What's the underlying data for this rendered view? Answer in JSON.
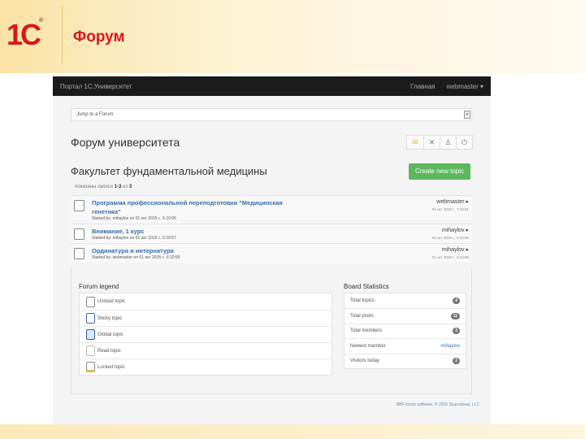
{
  "header": {
    "logo": "1С",
    "title": "Форум"
  },
  "nav": {
    "brand": "Портал 1С:Университет",
    "home": "Главная",
    "user": "webmaster ▾"
  },
  "jump": {
    "value": "Jump to a Forum"
  },
  "forum_title": "Форум университета",
  "toolbar_icons": [
    "envelope-icon",
    "tools-icon",
    "user-icon",
    "power-icon"
  ],
  "faculty_title": "Факультет фундаментальной медицины",
  "create_label": "Create new topic",
  "count": {
    "prefix": "показаны записи ",
    "range": "1-3",
    "mid": " из ",
    "total": "3"
  },
  "topics": [
    {
      "title": "Программа профессиональной переподготовки \"Медицинская генетика\"",
      "started": "Started by: mihaylov on 01 окт 2015 г., 6:10:06",
      "last_user": "webmaster ▸",
      "last_date": "01 окт 2015 г., 7:10:01"
    },
    {
      "title": "Внимание, 1 курс",
      "started": "Started by: mihaylov on 01 окт 2015 г., 6:10:57",
      "last_user": "mihaylov ▸",
      "last_date": "01 окт 2015 г., 6:10:58"
    },
    {
      "title": "Ординатура и интернатура",
      "started": "Started by: webmaster on 01 окт 2015 г., 6:10:55",
      "last_user": "mihaylov ▸",
      "last_date": "01 окт 2015 г., 6:10:56"
    }
  ],
  "legend": {
    "title": "Forum legend",
    "items": [
      "Unread topic",
      "Sticky topic",
      "Global topic",
      "Read topic",
      "Locked topic"
    ]
  },
  "stats": {
    "title": "Board Statistics",
    "total_topics_label": "Total topics",
    "total_topics": "4",
    "total_posts_label": "Total posts",
    "total_posts": "11",
    "total_members_label": "Total members",
    "total_members": "3",
    "newest_label": "Newest member",
    "newest": "mihaylov",
    "visitors_label": "Visitors today",
    "visitors": "2"
  },
  "credit": "BBF forum software, © 2015 Sourcebeat, LLC"
}
